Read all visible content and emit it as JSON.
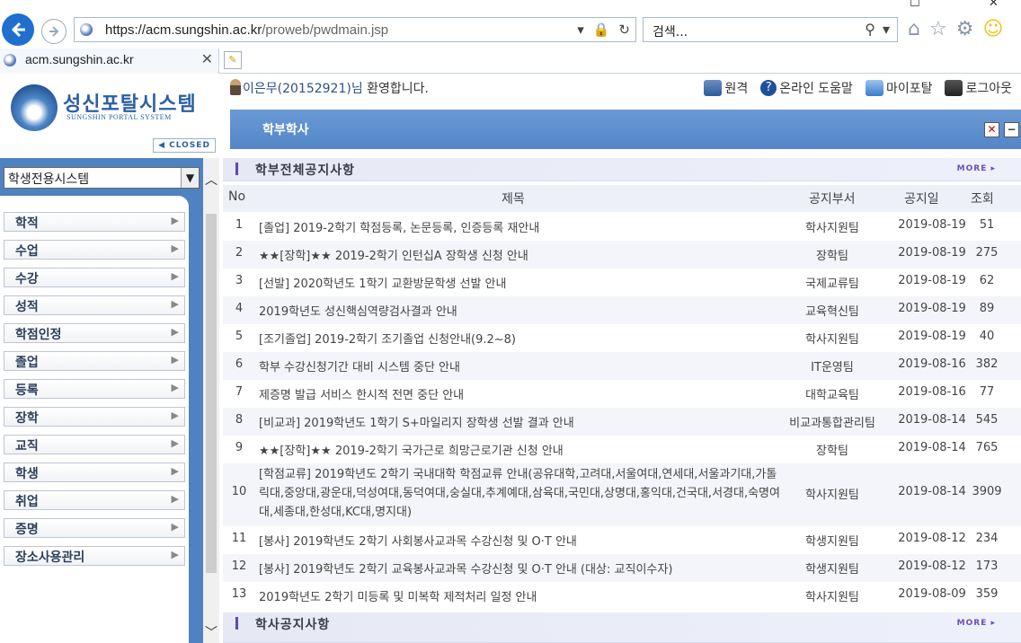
{
  "browser": {
    "url_host": "https://acm.sungshin.ac.kr",
    "url_path": "/proweb/pwdmain.jsp",
    "search_placeholder": "검색...",
    "tab_title": "acm.sungshin.ac.kr",
    "icons": [
      "back-icon",
      "forward-icon",
      "lock-icon",
      "refresh-icon",
      "search-icon",
      "home-icon",
      "star-icon",
      "gear-icon",
      "smiley-icon"
    ]
  },
  "portal": {
    "logo_title": "성신포탈시스템",
    "logo_subtitle": "SUNGSHIN PORTAL SYSTEM",
    "closed_label": "CLOSED",
    "welcome_user": "이은무(20152921)님",
    "welcome_suffix": " 환영합니다.",
    "top_links": [
      {
        "label": "원격",
        "icon": "monitor-icon"
      },
      {
        "label": "온라인 도움말",
        "icon": "help-icon"
      },
      {
        "label": "마이포탈",
        "icon": "folder-icon"
      },
      {
        "label": "로그아웃",
        "icon": "logout-icon"
      }
    ],
    "page_title": "학부학사",
    "accent_color": "#5386c8"
  },
  "sidebar": {
    "system_select": "학생전용시스템",
    "items": [
      {
        "label": "학적"
      },
      {
        "label": "수업"
      },
      {
        "label": "수강"
      },
      {
        "label": "성적"
      },
      {
        "label": "학점인정"
      },
      {
        "label": "졸업"
      },
      {
        "label": "등록"
      },
      {
        "label": "장학"
      },
      {
        "label": "교직"
      },
      {
        "label": "학생"
      },
      {
        "label": "취업"
      },
      {
        "label": "증명"
      },
      {
        "label": "장소사용관리"
      }
    ]
  },
  "notices": {
    "title": "학부전체공지사항",
    "more_label": "MORE",
    "columns": {
      "no": "No",
      "title": "제목",
      "dept": "공지부서",
      "date": "공지일",
      "views": "조회"
    },
    "rows": [
      {
        "no": "1",
        "title": "[졸업] 2019-2학기 학점등록, 논문등록, 인증등록 재안내",
        "dept": "학사지원팀",
        "date": "2019-08-19",
        "views": "51"
      },
      {
        "no": "2",
        "title": "★★[장학]★★ 2019-2학기 인턴십A 장학생 신청 안내",
        "dept": "장학팀",
        "date": "2019-08-19",
        "views": "275"
      },
      {
        "no": "3",
        "title": "[선발] 2020학년도 1학기 교환방문학생 선발 안내",
        "dept": "국제교류팀",
        "date": "2019-08-19",
        "views": "62"
      },
      {
        "no": "4",
        "title": "2019학년도 성신핵심역량검사결과 안내",
        "dept": "교육혁신팀",
        "date": "2019-08-19",
        "views": "89"
      },
      {
        "no": "5",
        "title": "[조기졸업] 2019-2학기 조기졸업 신청안내(9.2~8)",
        "dept": "학사지원팀",
        "date": "2019-08-19",
        "views": "40"
      },
      {
        "no": "6",
        "title": "학부 수강신청기간 대비 시스템 중단 안내",
        "dept": "IT운영팀",
        "date": "2019-08-16",
        "views": "382"
      },
      {
        "no": "7",
        "title": "제증명 발급 서비스 한시적 전면 중단 안내",
        "dept": "대학교육팀",
        "date": "2019-08-16",
        "views": "77"
      },
      {
        "no": "8",
        "title": "[비교과] 2019학년도 1학기 S+마일리지 장학생 선발 결과 안내",
        "dept": "비교과통합관리팀",
        "date": "2019-08-14",
        "views": "545"
      },
      {
        "no": "9",
        "title": "★★[장학]★★ 2019-2학기 국가근로 희망근로기관 신청 안내",
        "dept": "장학팀",
        "date": "2019-08-14",
        "views": "765"
      },
      {
        "no": "10",
        "title": "[학점교류] 2019학년도 2학기 국내대학 학점교류 안내(공유대학,고려대,서울여대,연세대,서울과기대,가톨릭대,중앙대,광운대,덕성여대,동덕여대,숭실대,추계예대,삼육대,국민대,상명대,홍익대,건국대,서경대,숙명여대,세종대,한성대,KC대,명지대)",
        "dept": "학사지원팀",
        "date": "2019-08-14",
        "views": "3909"
      },
      {
        "no": "11",
        "title": "[봉사] 2019학년도 2학기 사회봉사교과목 수강신청 및 O·T 안내",
        "dept": "학생지원팀",
        "date": "2019-08-12",
        "views": "234"
      },
      {
        "no": "12",
        "title": "[봉사] 2019학년도 2학기 교육봉사교과목 수강신청 및 O·T 안내 (대상: 교직이수자)",
        "dept": "학생지원팀",
        "date": "2019-08-12",
        "views": "173"
      },
      {
        "no": "13",
        "title": "2019학년도 2학기 미등록 및 미복학 제적처리 일정 안내",
        "dept": "학사지원팀",
        "date": "2019-08-09",
        "views": "359"
      }
    ]
  },
  "academic_notices": {
    "title": "학사공지사항",
    "more_label": "MORE"
  }
}
